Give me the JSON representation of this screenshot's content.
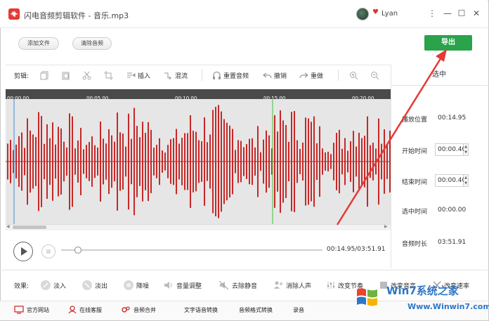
{
  "app": {
    "title": "闪电音频剪辑软件 - 音乐.mp3",
    "username": "Lyan"
  },
  "window_controls": [
    "⋮",
    "—",
    "☐",
    "✕"
  ],
  "actions": {
    "add_file": "添加文件",
    "clear_audio": "清除音频",
    "export": "导出"
  },
  "toolbar": {
    "label": "剪辑:",
    "insert": "插入",
    "mix": "混流",
    "rerecord": "重置音频",
    "undo": "撤销",
    "redo": "重做"
  },
  "ruler": {
    "ticks": [
      "00:00.00",
      "00:05.00",
      "00:10.00",
      "00:15.00",
      "00:20.00"
    ]
  },
  "selection_panel": {
    "title": "选中",
    "play_position_label": "播放位置",
    "play_position": "00:14.95",
    "start_label": "开始时间",
    "start": "00:00.40",
    "end_label": "结束时间",
    "end": "00:00.40",
    "selected_label": "选中时间",
    "selected": "00:00.00",
    "duration_label": "音频时长",
    "duration": "03:51.91"
  },
  "transport": {
    "time": "00:14.95/03:51.91",
    "progress": 0.064
  },
  "effects": {
    "label": "效果:",
    "items": [
      "淡入",
      "淡出",
      "降噪",
      "音量调整",
      "去除静音",
      "消除人声",
      "改变节奏",
      "改变音高",
      "改变速率"
    ]
  },
  "bottom_bar": {
    "items": [
      "官方网站",
      "在线客服",
      "音频合并",
      "文字语音转换",
      "音频格式转换",
      "录音"
    ]
  },
  "watermark": {
    "brand": "Win7系统之家",
    "url": "Www.Winwin7.com"
  },
  "colors": {
    "accent": "#2aa34a",
    "waveform": "#c62828",
    "logo": "#e53935",
    "playhead": "#5bc85b",
    "cursor": "#3b8fd8",
    "arrow": "#e53935"
  }
}
